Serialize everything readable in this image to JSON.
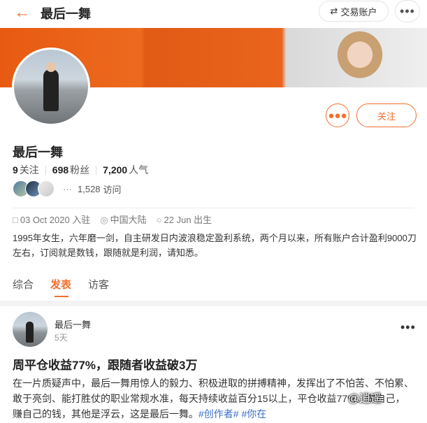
{
  "header": {
    "back_icon": "back-arrow-icon",
    "title": "最后一舞",
    "trade_account_label": "交易账户",
    "trade_icon": "swap-icon",
    "more_label": "•••"
  },
  "profile": {
    "name": "最后一舞",
    "message_icon": "chat-bubble-icon",
    "follow_label": "关注",
    "stats": {
      "following_value": "9",
      "following_label": "关注",
      "fans_value": "698",
      "fans_label": "粉丝",
      "popularity_value": "7,200",
      "popularity_label": "人气"
    },
    "visitors": {
      "more": "···",
      "count": "1,528",
      "label": "访问"
    },
    "meta": {
      "joined": "03 Oct 2020 入驻",
      "location": "中国大陆",
      "birthday": "22 Jun 出生"
    },
    "bio": "1995年女生，六年磨一剑，自主研发日内波浪稳定盈利系统，两个月以来，所有账户合计盈利9000刀左右，订阅就是数钱，跟随就是利润，请知悉。"
  },
  "tabs": [
    {
      "label": "综合",
      "active": false
    },
    {
      "label": "发表",
      "active": true
    },
    {
      "label": "访客",
      "active": false
    }
  ],
  "post": {
    "author": "最后一舞",
    "time": "5天",
    "more_label": "•••",
    "title": "周平仓收益77%，跟随者收益破3万",
    "body": "在一片质疑声中，最后一舞用惊人的毅力、积极进取的拼搏精神，发挥出了不怕苦、不怕累、敢于亮剑、能打胜仗的职业常规水准，每天持续收益百分15以上，",
    "body_end": "平仓收益77%。做自己，赚自己的钱，其他是浮云，这是最后一舞。",
    "tags": "#创作者# #你在"
  },
  "watermark": "@逍遥",
  "colors": {
    "accent": "#f26f2c",
    "link": "#3b6fc7"
  }
}
